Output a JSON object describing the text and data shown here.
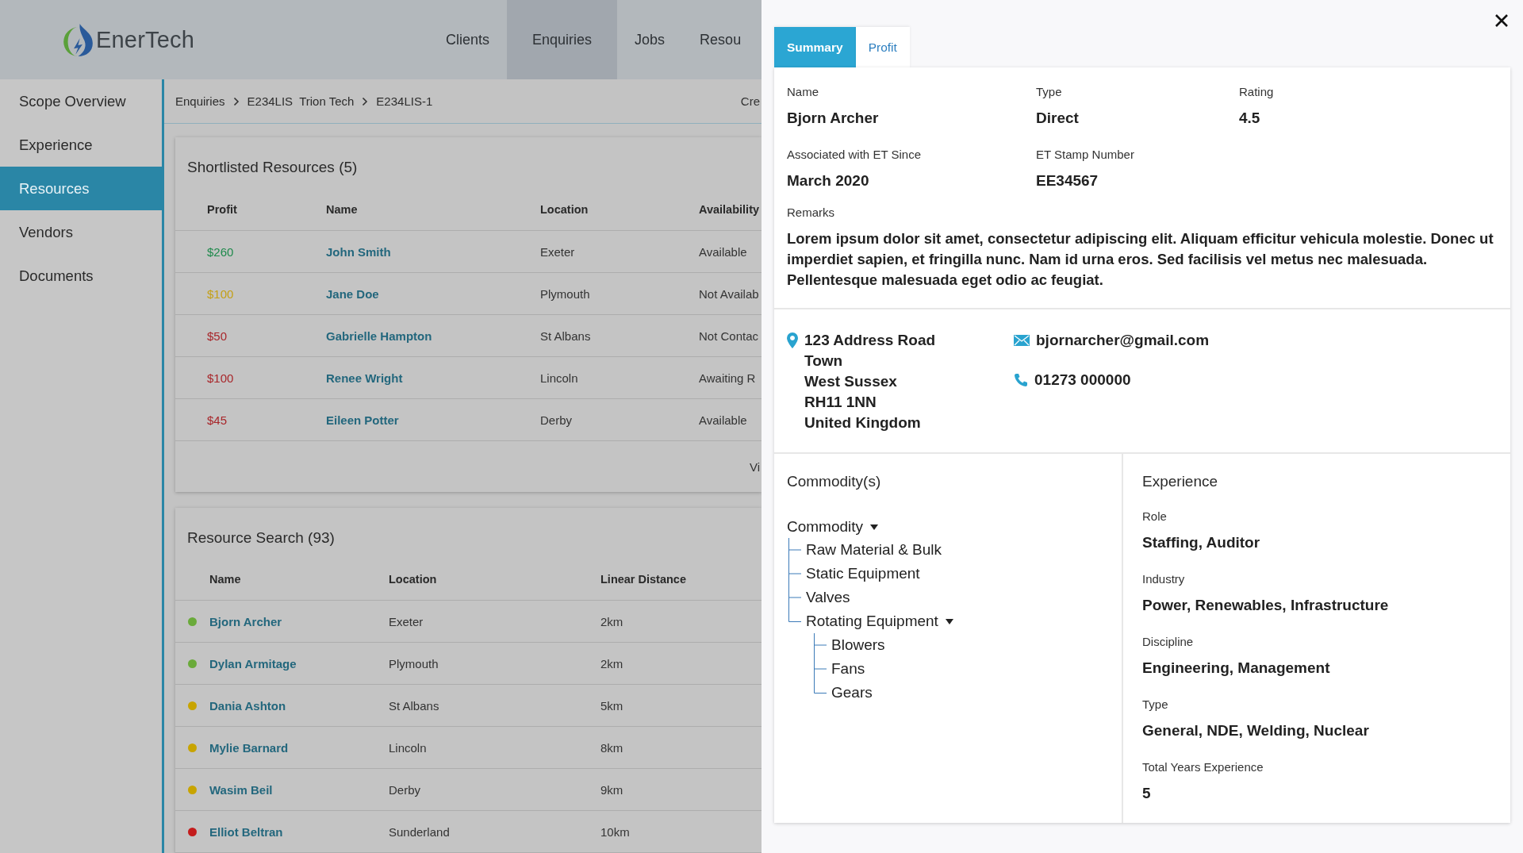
{
  "header": {
    "brand": "EnerTech",
    "nav": [
      {
        "label": "Clients",
        "selected": false
      },
      {
        "label": "Enquiries",
        "selected": true
      },
      {
        "label": "Jobs",
        "selected": false
      },
      {
        "label": "Resou",
        "selected": false
      }
    ]
  },
  "sidebar": {
    "items": [
      {
        "label": "Scope Overview",
        "selected": false
      },
      {
        "label": "Experience",
        "selected": false
      },
      {
        "label": "Resources",
        "selected": true
      },
      {
        "label": "Vendors",
        "selected": false
      },
      {
        "label": "Documents",
        "selected": false
      }
    ]
  },
  "breadcrumb": {
    "items": [
      "Enquiries",
      "E234LIS  Trion Tech",
      "E234LIS-1"
    ],
    "action": "Cre"
  },
  "shortlisted": {
    "title": "Shortlisted Resources (5)",
    "columns": [
      "Profit",
      "Name",
      "Location",
      "Availability"
    ],
    "rows": [
      {
        "profit": "$260",
        "color": "#1f8a4c",
        "name": "John Smith",
        "location": "Exeter",
        "availability": "Available"
      },
      {
        "profit": "$100",
        "color": "#c4a016",
        "name": "Jane Doe",
        "location": "Plymouth",
        "availability": "Not Availab"
      },
      {
        "profit": "$50",
        "color": "#a8262a",
        "name": "Gabrielle Hampton",
        "location": "St Albans",
        "availability": "Not Contac"
      },
      {
        "profit": "$100",
        "color": "#a8262a",
        "name": "Renee Wright",
        "location": "Lincoln",
        "availability": "Awaiting R"
      },
      {
        "profit": "$45",
        "color": "#a8262a",
        "name": "Eileen Potter",
        "location": "Derby",
        "availability": "Available"
      }
    ],
    "footer_link": "Vi"
  },
  "resource_search": {
    "title": "Resource Search (93)",
    "columns": [
      "Name",
      "Location",
      "Linear Distance"
    ],
    "rows": [
      {
        "color": "#6aaa3a",
        "name": "Bjorn Archer",
        "location": "Exeter",
        "distance": "2km"
      },
      {
        "color": "#6aaa3a",
        "name": "Dylan Armitage",
        "location": "Plymouth",
        "distance": "2km"
      },
      {
        "color": "#c8a400",
        "name": "Dania Ashton",
        "location": "St Albans",
        "distance": "5km"
      },
      {
        "color": "#c8a400",
        "name": "Mylie Barnard",
        "location": "Lincoln",
        "distance": "8km"
      },
      {
        "color": "#c8a400",
        "name": "Wasim Beil",
        "location": "Derby",
        "distance": "9km"
      },
      {
        "color": "#c41c1c",
        "name": "Elliot Beltran",
        "location": "Sunderland",
        "distance": "10km"
      }
    ]
  },
  "drawer": {
    "tabs": [
      {
        "label": "Summary",
        "selected": true
      },
      {
        "label": "Profit",
        "selected": false
      }
    ],
    "fields": [
      {
        "label": "Name",
        "value": "Bjorn Archer"
      },
      {
        "label": "Type",
        "value": "Direct"
      },
      {
        "label": "Rating",
        "value": "4.5"
      },
      {
        "label": "Associated with ET Since",
        "value": "March 2020"
      },
      {
        "label": "ET Stamp Number",
        "value": "EE34567"
      }
    ],
    "remarks": {
      "label": "Remarks",
      "value": "Lorem ipsum dolor sit amet, consectetur adipiscing elit. Aliquam efficitur vehicula molestie. Donec ut imperdiet sapien, et fringilla nunc. Nam id urna eros. Sed facilisis vel metus nec malesuada. Pellentesque malesuada eget odio ac feugiat."
    },
    "address": [
      "123 Address Road",
      "Town",
      "West Sussex",
      "RH11 1NN",
      "United Kingdom"
    ],
    "email": "bjornarcher@gmail.com",
    "phone": "01273 000000",
    "commodities": {
      "title": "Commodity(s)",
      "tree": [
        {
          "label": "Commodity",
          "expanded": true,
          "children": [
            {
              "label": "Raw Material & Bulk"
            },
            {
              "label": "Static Equipment"
            },
            {
              "label": "Valves"
            },
            {
              "label": "Rotating Equipment",
              "expanded": true,
              "children": [
                {
                  "label": "Blowers"
                },
                {
                  "label": "Fans"
                },
                {
                  "label": "Gears"
                }
              ]
            }
          ]
        }
      ]
    },
    "experience": {
      "title": "Experience",
      "fields": [
        {
          "label": "Role",
          "value": "Staffing, Auditor"
        },
        {
          "label": "Industry",
          "value": "Power, Renewables, Infrastructure"
        },
        {
          "label": "Discipline",
          "value": "Engineering, Management"
        },
        {
          "label": "Type",
          "value": "General, NDE, Welding, Nuclear"
        },
        {
          "label": "Total Years Experience",
          "value": "5"
        }
      ]
    }
  }
}
